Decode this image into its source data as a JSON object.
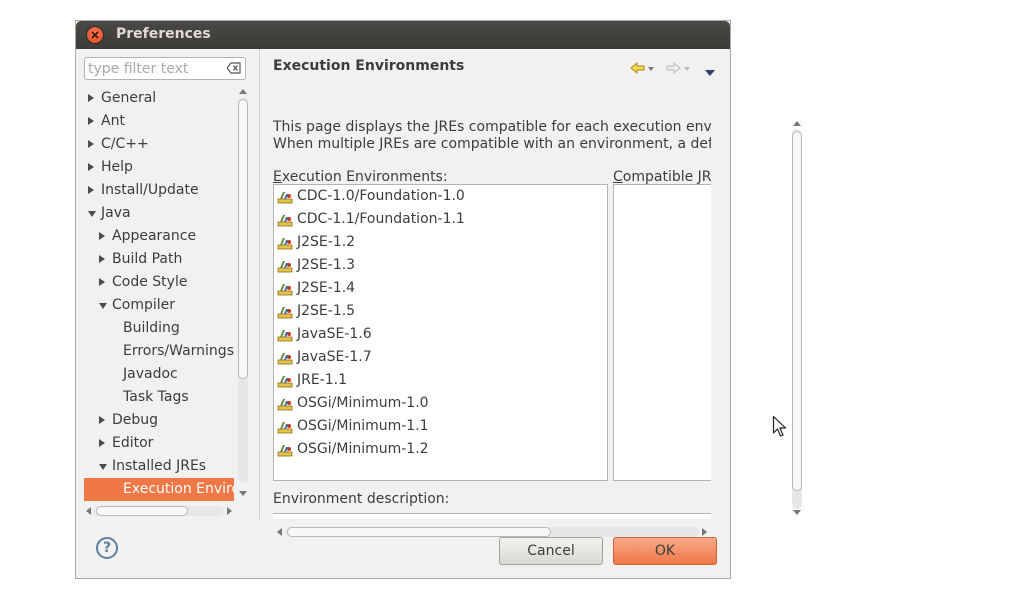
{
  "window": {
    "title": "Preferences"
  },
  "filter": {
    "placeholder": "type filter text"
  },
  "tree": [
    {
      "label": "General",
      "level": 0,
      "state": "closed"
    },
    {
      "label": "Ant",
      "level": 0,
      "state": "closed"
    },
    {
      "label": "C/C++",
      "level": 0,
      "state": "closed"
    },
    {
      "label": "Help",
      "level": 0,
      "state": "closed"
    },
    {
      "label": "Install/Update",
      "level": 0,
      "state": "closed"
    },
    {
      "label": "Java",
      "level": 0,
      "state": "open"
    },
    {
      "label": "Appearance",
      "level": 1,
      "state": "closed"
    },
    {
      "label": "Build Path",
      "level": 1,
      "state": "closed"
    },
    {
      "label": "Code Style",
      "level": 1,
      "state": "closed"
    },
    {
      "label": "Compiler",
      "level": 1,
      "state": "open"
    },
    {
      "label": "Building",
      "level": 2,
      "state": "leaf"
    },
    {
      "label": "Errors/Warnings",
      "level": 2,
      "state": "leaf"
    },
    {
      "label": "Javadoc",
      "level": 2,
      "state": "leaf"
    },
    {
      "label": "Task Tags",
      "level": 2,
      "state": "leaf"
    },
    {
      "label": "Debug",
      "level": 1,
      "state": "closed"
    },
    {
      "label": "Editor",
      "level": 1,
      "state": "closed"
    },
    {
      "label": "Installed JREs",
      "level": 1,
      "state": "open"
    },
    {
      "label": "Execution Enviro",
      "level": 2,
      "state": "leaf",
      "selected": true
    }
  ],
  "page": {
    "title": "Execution Environments",
    "desc_line1": "This page displays the JREs compatible for each execution enviror",
    "desc_line2": "When multiple JREs are compatible with an environment, a defaul",
    "env_label_mnemonic": "E",
    "env_label_rest": "xecution Environments:",
    "compat_label_mnemonic": "C",
    "compat_label_rest": "ompatible JR",
    "env_desc_label": "Environment description:"
  },
  "environments": [
    "CDC-1.0/Foundation-1.0",
    "CDC-1.1/Foundation-1.1",
    "J2SE-1.2",
    "J2SE-1.3",
    "J2SE-1.4",
    "J2SE-1.5",
    "JavaSE-1.6",
    "JavaSE-1.7",
    "JRE-1.1",
    "OSGi/Minimum-1.0",
    "OSGi/Minimum-1.1",
    "OSGi/Minimum-1.2"
  ],
  "buttons": {
    "help": "?",
    "cancel": "Cancel",
    "ok": "OK"
  },
  "colors": {
    "selection": "#f07746",
    "titlebar": "#3c3b37",
    "accent_ok": "#f07746"
  }
}
